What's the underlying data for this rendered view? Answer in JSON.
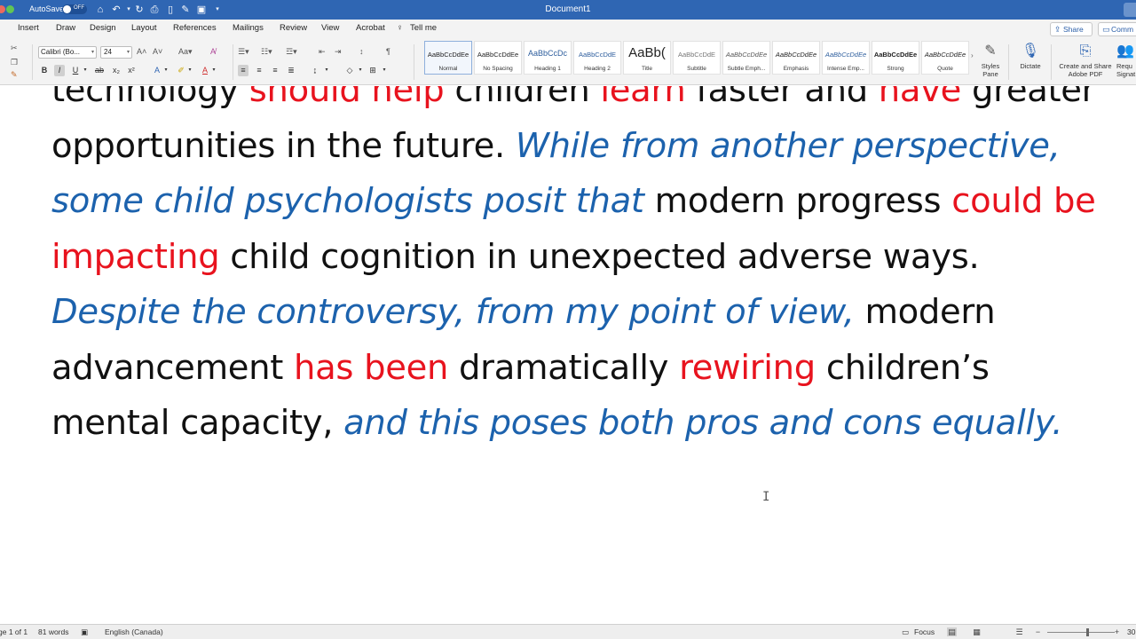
{
  "titlebar": {
    "autosave": "AutoSave",
    "toggle_state": "OFF",
    "document_title": "Document1",
    "qat_icons": [
      "home-icon",
      "undo-icon",
      "chevron-down-icon",
      "redo-icon",
      "print-icon",
      "new-doc-icon",
      "edit-icon",
      "save-icon",
      "customize-icon"
    ]
  },
  "ribbon": {
    "tabs": [
      "Insert",
      "Draw",
      "Design",
      "Layout",
      "References",
      "Mailings",
      "Review",
      "View",
      "Acrobat",
      "Tell me"
    ],
    "share_label": "Share",
    "comments_label": "Comm",
    "font_name": "Calibri (Bo...",
    "font_size": "24",
    "styles": [
      {
        "sample": "AaBbCcDdEe",
        "name": "Normal"
      },
      {
        "sample": "AaBbCcDdEe",
        "name": "No Spacing"
      },
      {
        "sample": "AaBbCcDc",
        "name": "Heading 1"
      },
      {
        "sample": "AaBbCcDdE",
        "name": "Heading 2"
      },
      {
        "sample": "AaBb(",
        "name": "Title"
      },
      {
        "sample": "AaBbCcDdE",
        "name": "Subtitle"
      },
      {
        "sample": "AaBbCcDdEe",
        "name": "Subtle Emph..."
      },
      {
        "sample": "AaBbCcDdEe",
        "name": "Emphasis"
      },
      {
        "sample": "AaBbCcDdEe",
        "name": "Intense Emp..."
      },
      {
        "sample": "AaBbCcDdEe",
        "name": "Strong"
      },
      {
        "sample": "AaBbCcDdEe",
        "name": "Quote"
      }
    ],
    "styles_pane": "Styles Pane",
    "dictate": "Dictate",
    "create_share": "Create and Share Adobe PDF",
    "request_sig": "Requ Signat"
  },
  "document": {
    "segments": [
      {
        "text": "technology ",
        "style": "normal"
      },
      {
        "text": "should help",
        "style": "red"
      },
      {
        "text": " children ",
        "style": "normal"
      },
      {
        "text": "learn",
        "style": "red"
      },
      {
        "text": " faster and ",
        "style": "normal"
      },
      {
        "text": "have",
        "style": "red"
      },
      {
        "text": " greater opportunities in the future. ",
        "style": "normal"
      },
      {
        "text": "While from another perspective, some child psychologists posit that",
        "style": "blue"
      },
      {
        "text": " modern progress ",
        "style": "normal"
      },
      {
        "text": "could be impacting",
        "style": "red"
      },
      {
        "text": " child cognition in unexpected adverse ways. ",
        "style": "normal"
      },
      {
        "text": "Despite the controversy, from my point of view,",
        "style": "blue"
      },
      {
        "text": " modern advancement ",
        "style": "normal"
      },
      {
        "text": "has been",
        "style": "red"
      },
      {
        "text": " dramatically ",
        "style": "normal"
      },
      {
        "text": "rewiring",
        "style": "red"
      },
      {
        "text": " children’s mental capacity, ",
        "style": "normal"
      },
      {
        "text": "and this poses both pros and cons equally.",
        "style": "blue"
      }
    ]
  },
  "statusbar": {
    "page": "ge 1 of 1",
    "words": "81 words",
    "language": "English (Canada)",
    "focus": "Focus",
    "zoom_percent_visible": "30"
  },
  "colors": {
    "title_bar": "#2f66b3",
    "emphasis_red": "#e8131e",
    "emphasis_blue": "#1c62ad"
  }
}
